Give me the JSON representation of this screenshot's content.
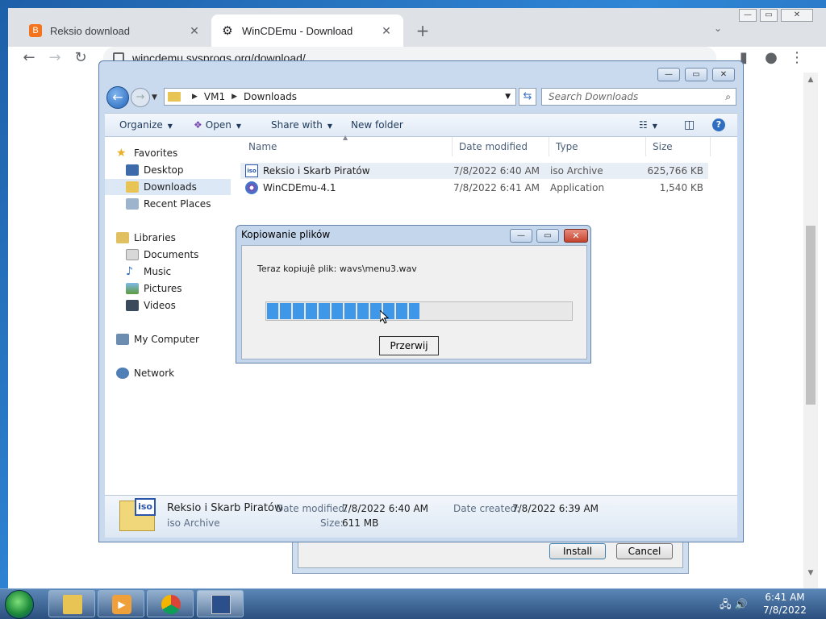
{
  "browser": {
    "tabs": [
      {
        "title": "Reksio download",
        "favicon": "blogger-icon",
        "color": "#f4741e"
      },
      {
        "title": "WinCDEmu - Download",
        "favicon": "gear-icon",
        "color": "#202124"
      }
    ],
    "url": "wincdemu.sysprogs.org/download/"
  },
  "explorer": {
    "breadcrumb": [
      "VM1",
      "Downloads"
    ],
    "search_placeholder": "Search Downloads",
    "commands": {
      "organize": "Organize",
      "open": "Open",
      "share": "Share with",
      "new_folder": "New folder"
    },
    "nav": {
      "favorites": "Favorites",
      "desktop": "Desktop",
      "downloads": "Downloads",
      "recent": "Recent Places",
      "libraries": "Libraries",
      "documents": "Documents",
      "music": "Music",
      "pictures": "Pictures",
      "videos": "Videos",
      "computer": "My Computer",
      "network": "Network"
    },
    "columns": {
      "name": "Name",
      "date": "Date modified",
      "type": "Type",
      "size": "Size"
    },
    "files": [
      {
        "name": "Reksio i Skarb Piratów",
        "date": "7/8/2022 6:40 AM",
        "type": "iso Archive",
        "size": "625,766 KB"
      },
      {
        "name": "WinCDEmu-4.1",
        "date": "7/8/2022 6:41 AM",
        "type": "Application",
        "size": "1,540 KB"
      }
    ],
    "details": {
      "name": "Reksio i Skarb Piratów",
      "type": "iso Archive",
      "date_modified_label": "Date modified:",
      "date_modified": "7/8/2022 6:40 AM",
      "date_created_label": "Date created:",
      "date_created": "7/8/2022 6:39 AM",
      "size_label": "Size:",
      "size": "611 MB",
      "icon_tag": "iso"
    }
  },
  "copy_dialog": {
    "title": "Kopiowanie plików",
    "message": "Teraz kopiujê plik: wavs\\menu3.wav",
    "progress_fraction": 0.5,
    "abort_label": "Przerwij"
  },
  "installer": {
    "install_label": "Install",
    "cancel_label": "Cancel"
  },
  "taskbar": {
    "time": "6:41 AM",
    "date": "7/8/2022"
  }
}
